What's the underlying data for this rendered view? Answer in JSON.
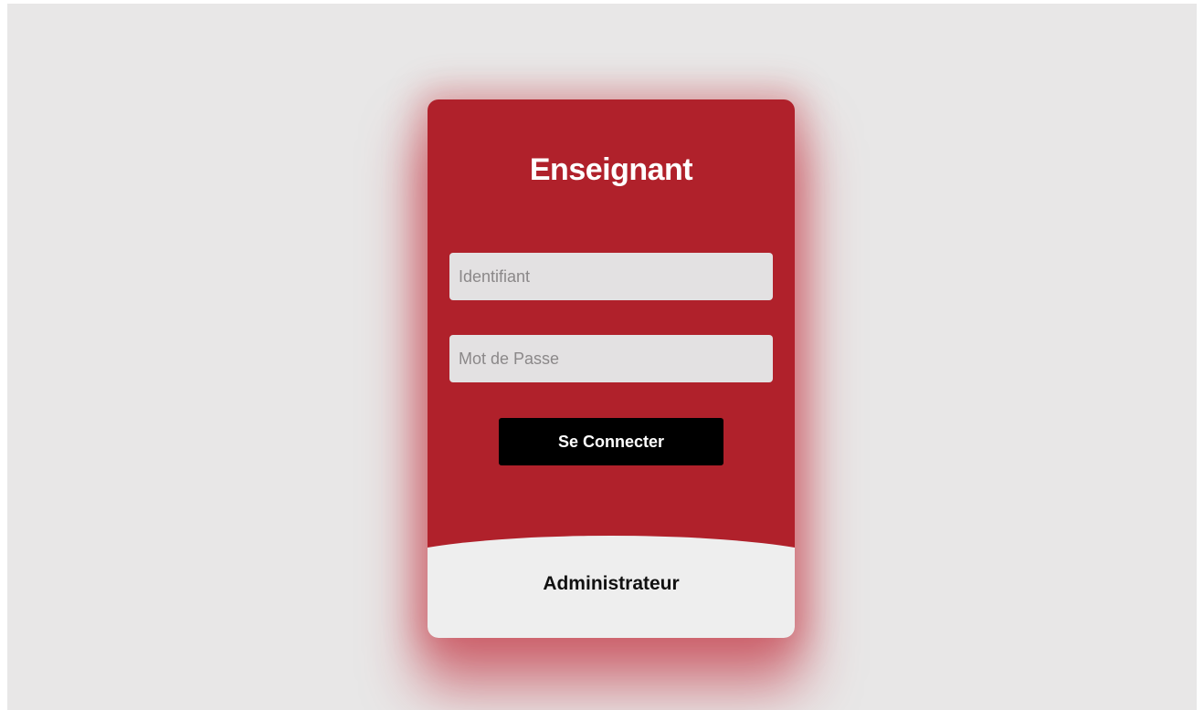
{
  "login": {
    "title": "Enseignant",
    "username_placeholder": "Identifiant",
    "password_placeholder": "Mot de Passe",
    "submit_label": "Se Connecter",
    "admin_link_label": "Administrateur"
  },
  "colors": {
    "page_background": "#e8e7e7",
    "card_background": "#b0212b",
    "input_background": "#e3e1e2",
    "button_background": "#000000",
    "admin_tab_background": "#eeeeee"
  }
}
